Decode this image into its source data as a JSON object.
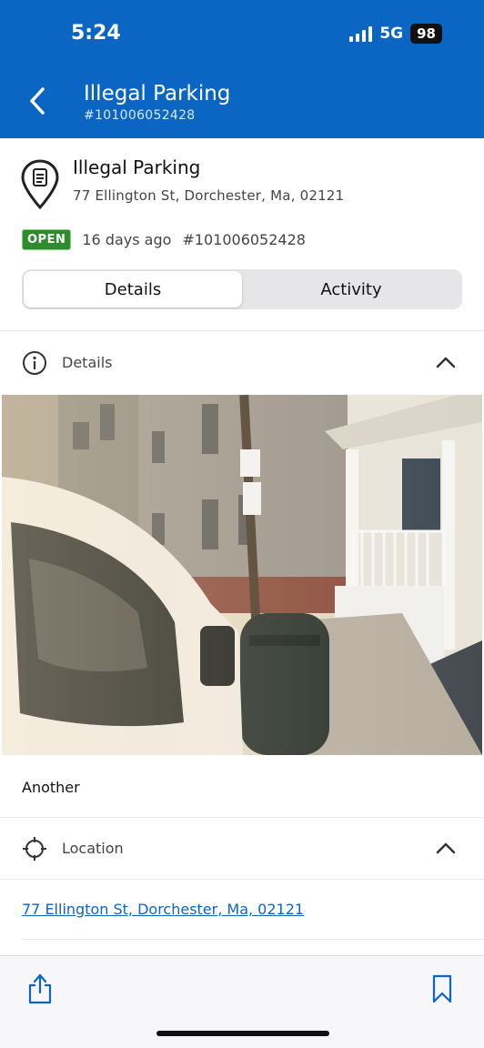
{
  "status_bar": {
    "time": "5:24",
    "network": "5G",
    "battery": "98"
  },
  "nav": {
    "title": "Illegal Parking",
    "subtitle": "#101006052428"
  },
  "request": {
    "title": "Illegal Parking",
    "address": "77 Ellington St, Dorchester, Ma, 02121",
    "status": "OPEN",
    "age": "16 days ago",
    "id": "#101006052428"
  },
  "tabs": [
    {
      "label": "Details",
      "selected": true
    },
    {
      "label": "Activity",
      "selected": false
    }
  ],
  "details_section": {
    "label": "Details",
    "photo_caption": "Another"
  },
  "location_section": {
    "label": "Location",
    "link": "77 Ellington St, Dorchester, Ma, 02121"
  },
  "colors": {
    "brand": "#0a66c2",
    "open_badge": "#2e8b2e",
    "link": "#0a66c2"
  },
  "icons": {
    "back": "chevron-left-icon",
    "pin": "location-pin-icon",
    "info": "info-icon",
    "crosshair": "crosshair-icon",
    "share": "share-icon",
    "bookmark": "bookmark-icon"
  }
}
